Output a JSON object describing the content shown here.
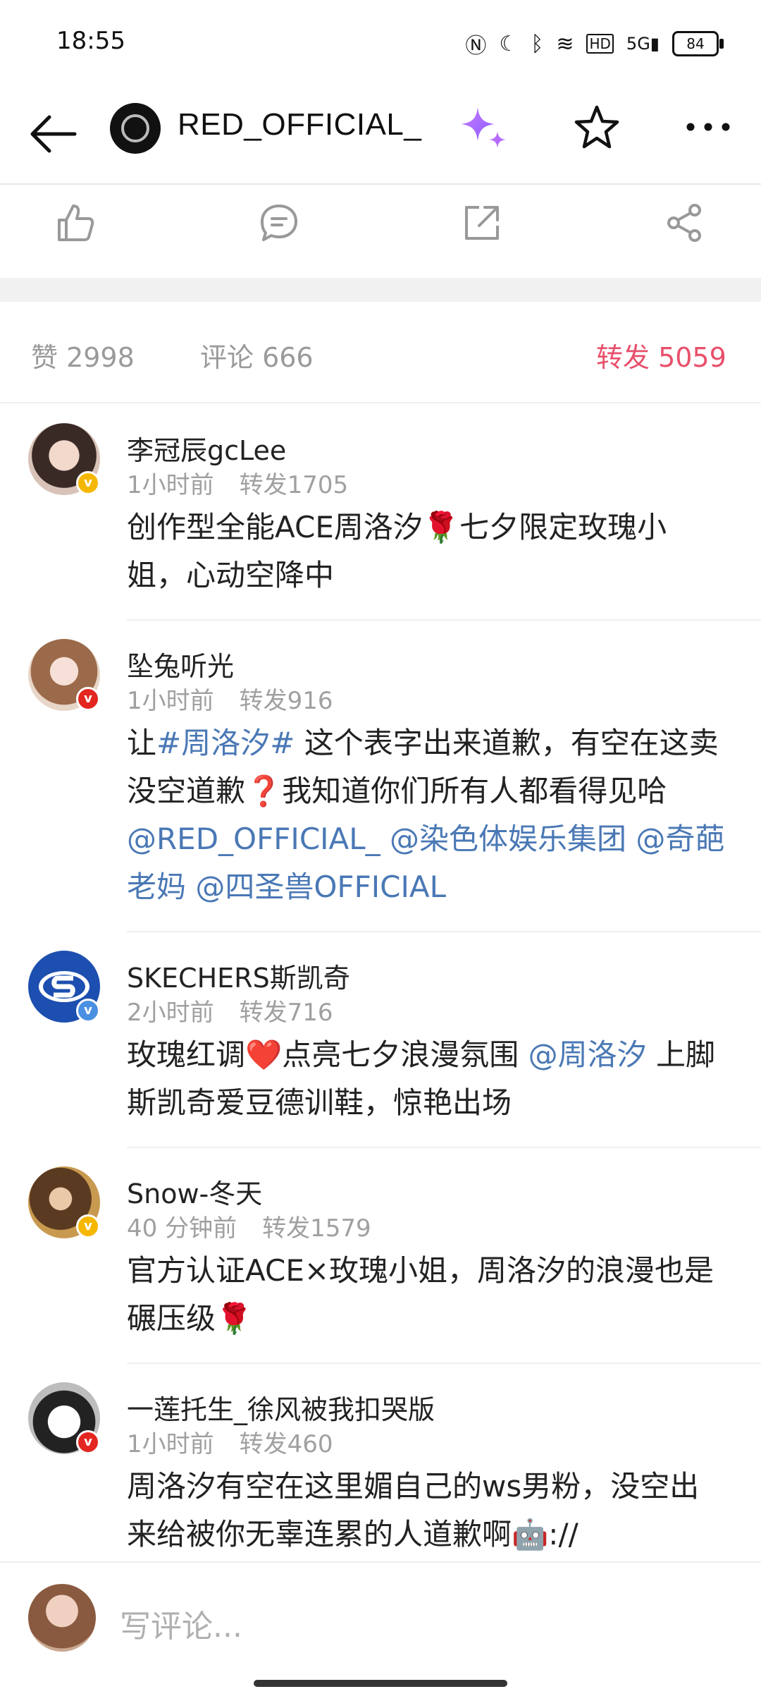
{
  "status": {
    "time": "18:55",
    "battery": "84"
  },
  "header": {
    "account_name": "RED_OFFICIAL_"
  },
  "stats": {
    "likes": "赞 2998",
    "comments": "评论 666",
    "reposts": "转发 5059"
  },
  "comments": [
    {
      "name": "李冠辰gcLee",
      "time": "1小时前",
      "reposts": "转发1705",
      "text": [
        "创作型全能ACE周洛汐🌹七夕限定玫瑰小姐，心动空降中"
      ]
    },
    {
      "name": "坠兔听光",
      "time": "1小时前",
      "reposts": "转发916",
      "text_parts": {
        "p1": "让",
        "tag": "#周洛汐#",
        "p2": " 这个表字出来道歉，有空在这卖没空道歉❓我知道你们所有人都看得见哈",
        "m1": "@RED_OFFICIAL_",
        "m2": " @染色体娱乐集团",
        "m3": " @奇葩老妈",
        "m4": " @四圣兽OFFICIAL"
      }
    },
    {
      "name": "SKECHERS斯凯奇",
      "time": "2小时前",
      "reposts": "转发716",
      "text_parts": {
        "p1": "玫瑰红调❤️点亮七夕浪漫氛围 ",
        "m1": "@周洛汐",
        "p2": " 上脚斯凯奇爱豆德训鞋，惊艳出场"
      }
    },
    {
      "name": "Snow-冬天",
      "time": "40 分钟前",
      "reposts": "转发1579",
      "text": [
        "官方认证ACE×玫瑰小姐，周洛汐的浪漫也是碾压级🌹"
      ]
    },
    {
      "name": "一莲托生_徐风被我扣哭版",
      "time": "1小时前",
      "reposts": "转发460",
      "text": [
        "周洛汐有空在这里媚自己的ws男粉，没空出来给被你无辜连累的人道歉啊🤖://"
      ]
    }
  ],
  "composer": {
    "placeholder": "写评论..."
  },
  "icons": {
    "back": "back-arrow-icon",
    "sparkle": "sparkle-icon",
    "star": "star-icon",
    "more": "more-icon",
    "like": "thumbs-up-icon",
    "comment": "comment-icon",
    "share_out": "external-share-icon",
    "share": "share-icon"
  },
  "colors": {
    "accent": "#e8506b",
    "link": "#4a78b5"
  }
}
